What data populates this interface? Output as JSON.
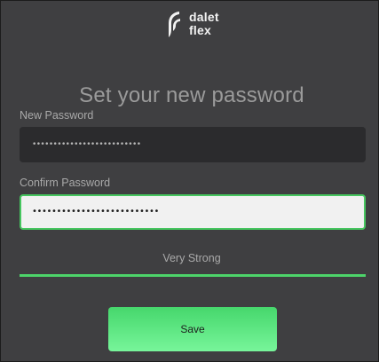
{
  "brand": {
    "line1": "dalet",
    "line2": "flex"
  },
  "page": {
    "title": "Set your new password"
  },
  "form": {
    "new_password_label": "New Password",
    "new_password_value": "••••••••••••••••••••••••••",
    "confirm_password_label": "Confirm Password",
    "confirm_password_value": "••••••••••••••••••••••••••",
    "strength_text": "Very Strong",
    "strength_level": 1.0,
    "save_label": "Save"
  },
  "colors": {
    "background": "#3f3f41",
    "accent_green": "#4dd46a",
    "field_dark": "#2b2b2d"
  }
}
